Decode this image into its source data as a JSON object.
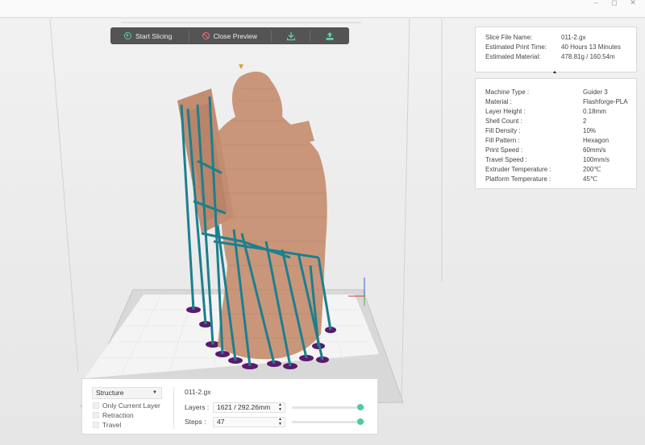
{
  "window": {
    "controls": [
      {
        "name": "minimize",
        "glyph": "–"
      },
      {
        "name": "maximize",
        "glyph": "◻"
      },
      {
        "name": "close",
        "glyph": "✕"
      }
    ]
  },
  "toolbar": {
    "start_label": "Start Slicing",
    "close_preview_label": "Close Preview",
    "icons": [
      "play-circle-icon",
      "ban-icon",
      "export-icon",
      "send-to-printer-icon"
    ],
    "colors": {
      "start": "#5fd0a4",
      "close": "#f07070",
      "background": "#545454"
    }
  },
  "slice_info": {
    "rows": [
      {
        "label": "Slice File Name:",
        "value": "011-2.gx"
      },
      {
        "label": "Estimated Print Time:",
        "value": "40 Hours 13 Minutes"
      },
      {
        "label": "Estimated Material:",
        "value": "478.81g / 160.54m"
      }
    ]
  },
  "print_settings": {
    "rows": [
      {
        "label": "Machine Type :",
        "value": "Guider 3"
      },
      {
        "label": "Material :",
        "value": "Flashforge-PLA"
      },
      {
        "label": "Layer Height :",
        "value": "0.18mm"
      },
      {
        "label": "Shell Count :",
        "value": "2"
      },
      {
        "label": "Fill Density :",
        "value": "10%"
      },
      {
        "label": "Fill Pattern :",
        "value": "Hexagon"
      },
      {
        "label": "Print Speed :",
        "value": "60mm/s"
      },
      {
        "label": "Travel Speed :",
        "value": "100mm/s"
      },
      {
        "label": "Extruder Temperature :",
        "value": "200℃"
      },
      {
        "label": "Platform Temperature :",
        "value": "45℃"
      }
    ]
  },
  "preview_panel": {
    "view_select": "Structure",
    "checkboxes": [
      {
        "label": "Only Current Layer",
        "checked": false
      },
      {
        "label": "Retraction",
        "checked": false
      },
      {
        "label": "Travel",
        "checked": false
      }
    ],
    "file_name": "011-2.gx",
    "layers_label": "Layers :",
    "layers_value": "1621 / 292.26mm",
    "layers_slider_fraction": 1.0,
    "steps_label": "Steps :",
    "steps_value": "47",
    "steps_slider_fraction": 1.0
  },
  "scene": {
    "model_color": "#c9967a",
    "support_color": "#1c7f8e",
    "raft_color": "#5b1a6d"
  }
}
